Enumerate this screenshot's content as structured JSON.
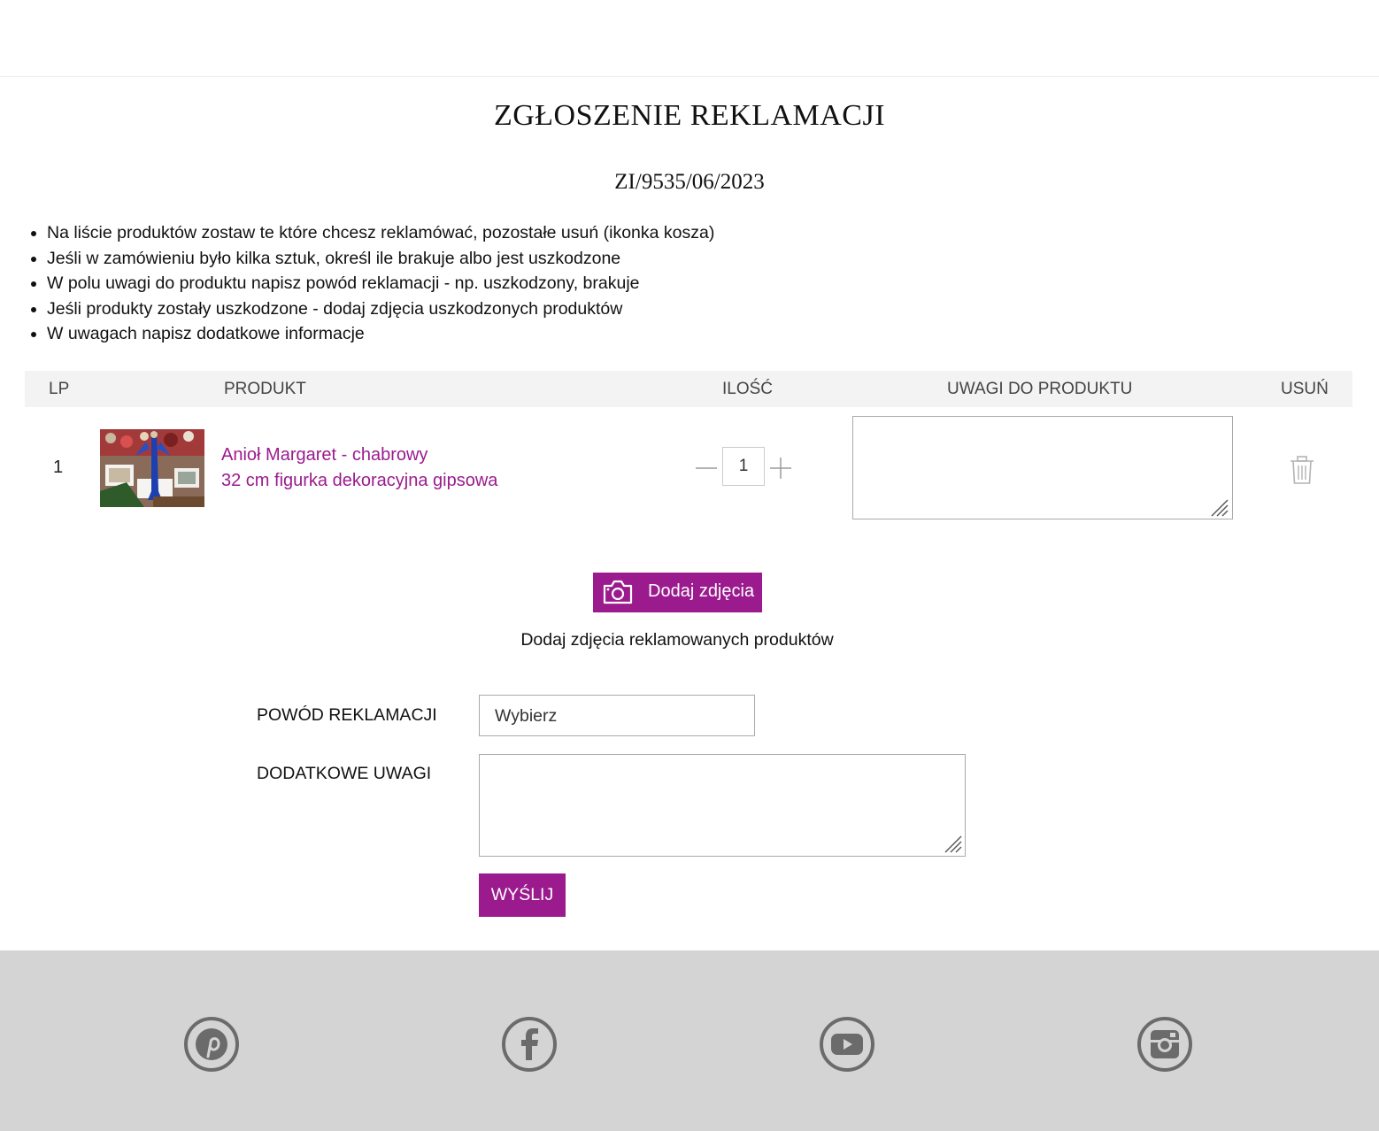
{
  "page": {
    "title": "ZGŁOSZENIE REKLAMACJI",
    "order_number": "ZI/9535/06/2023"
  },
  "instructions": [
    "Na liście produktów zostaw te które chcesz reklamówać, pozostałe usuń (ikonka kosza)",
    "Jeśli w zamówieniu było kilka sztuk, określ ile brakuje albo jest uszkodzone",
    "W polu uwagi do produktu napisz powód reklamacji - np. uszkodzony, brakuje",
    "Jeśli produkty zostały uszkodzone - dodaj zdjęcia uszkodzonych produktów",
    "W uwagach napisz dodatkowe informacje"
  ],
  "table": {
    "headers": {
      "lp": "LP",
      "product": "PRODUKT",
      "quantity": "ILOŚĆ",
      "notes": "UWAGI DO PRODUKTU",
      "remove": "USUŃ"
    },
    "rows": [
      {
        "lp": "1",
        "name_line1": "Anioł Margaret - chabrowy",
        "name_line2": "32 cm figurka dekoracyjna gipsowa",
        "quantity": "1",
        "notes": ""
      }
    ]
  },
  "photos": {
    "button_label": "Dodaj zdjęcia",
    "hint": "Dodaj zdjęcia reklamowanych produktów"
  },
  "form": {
    "reason_label": "POWÓD REKLAMACJI",
    "reason_value": "Wybierz",
    "extra_label": "DODATKOWE UWAGI",
    "extra_value": "",
    "submit_label": "WYŚLIJ"
  },
  "colors": {
    "accent": "#9b1b8e",
    "footer_bg": "#d4d4d4",
    "social_icon": "#6b6b6b"
  },
  "footer": {
    "social_icons": [
      "pinterest-icon",
      "facebook-icon",
      "youtube-icon",
      "instagram-icon"
    ]
  }
}
